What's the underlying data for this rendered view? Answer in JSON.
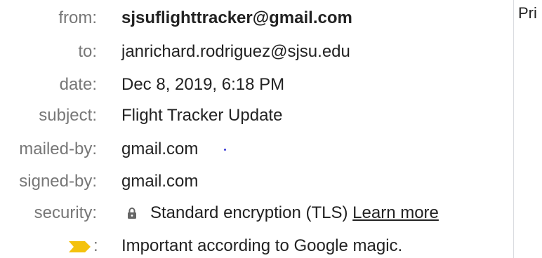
{
  "details": {
    "from": {
      "label": "from:",
      "value": "sjsuflighttracker@gmail.com"
    },
    "to": {
      "label": "to:",
      "value": "janrichard.rodriguez@sjsu.edu"
    },
    "date": {
      "label": "date:",
      "value": "Dec 8, 2019, 6:18 PM"
    },
    "subject": {
      "label": "subject:",
      "value": "Flight Tracker Update"
    },
    "mailed_by": {
      "label": "mailed-by:",
      "value": "gmail.com"
    },
    "signed_by": {
      "label": "signed-by:",
      "value": "gmail.com"
    },
    "security": {
      "label": "security:",
      "icon": "lock-icon",
      "value": "Standard encryption (TLS)",
      "link": "Learn more"
    },
    "importance": {
      "icon": "importance-marker-icon",
      "icon_color": "#f4c20d",
      "colon": ":",
      "value": "Important according to Google magic."
    }
  },
  "side_panel": {
    "text": "Pri"
  }
}
